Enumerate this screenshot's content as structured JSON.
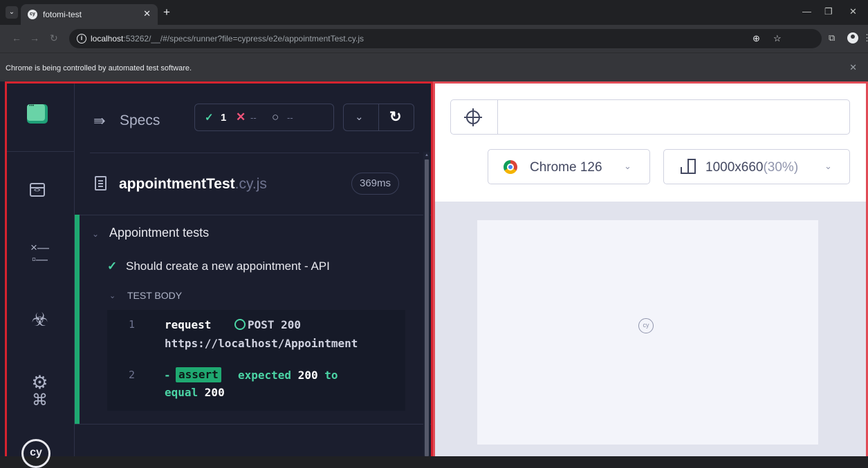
{
  "browser": {
    "tab_title": "fotomi-test",
    "url_host": "localhost",
    "url_rest": ":53262/__/#/specs/runner?file=cypress/e2e/appointmentTest.cy.js",
    "infobar_text": "Chrome is being controlled by automated test software.",
    "icons": [
      "tab-menu-icon",
      "favicon",
      "close-icon",
      "plus-icon",
      "minimize-icon",
      "restore-icon",
      "close-window-icon",
      "back-icon",
      "forward-icon",
      "reload-icon",
      "site-info-icon",
      "zoom-icon",
      "star-icon",
      "extensions-icon",
      "profile-icon",
      "kebab-menu-icon"
    ]
  },
  "colors": {
    "accent_green": "#1fa971",
    "pass_green": "#4bd4a5",
    "fail_pink": "#f2547a",
    "frame_red": "#d6232f",
    "app_bg": "#1b1e2e"
  },
  "sidenav": {
    "items": [
      {
        "name": "app-logo-icon"
      },
      {
        "name": "runner-icon"
      },
      {
        "name": "specs-list-icon"
      },
      {
        "name": "debug-icon"
      },
      {
        "name": "settings-icon"
      },
      {
        "name": "shortcuts-icon"
      },
      {
        "name": "cypress-logo-icon"
      }
    ]
  },
  "reporter": {
    "specs_label": "Specs",
    "stats": {
      "passed": "1",
      "failed": "--",
      "pending": "--"
    },
    "spec": {
      "name": "appointmentTest",
      "ext": ".cy.js",
      "duration": "369ms"
    },
    "suite": {
      "title": "Appointment tests"
    },
    "test": {
      "title": "Should create a new appointment - API"
    },
    "body_title": "TEST BODY",
    "commands": [
      {
        "num": "1",
        "name": "request",
        "msg_line1": "POST 200",
        "msg_line2": "https://localhost/Appointment"
      },
      {
        "num": "2",
        "dash": "-",
        "name": "assert",
        "text1": "expected ",
        "val1": "200",
        "text1b": " to",
        "text2": "equal ",
        "val2": "200"
      }
    ]
  },
  "aut": {
    "url_value": "",
    "browser_label": "Chrome 126",
    "viewport_size": "1000x660",
    "viewport_scale": "(30%)"
  }
}
